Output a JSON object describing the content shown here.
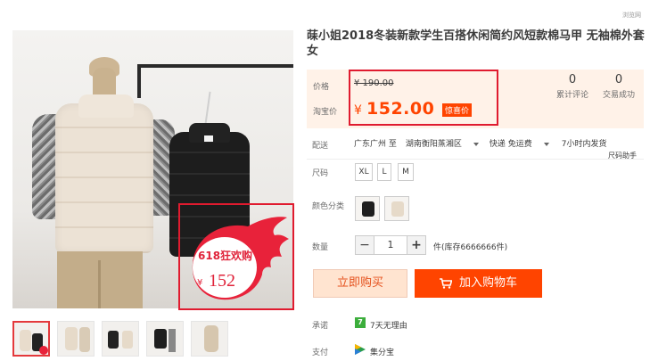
{
  "top_note": "浏览网",
  "promo": {
    "title": "618狂欢购",
    "currency": "¥",
    "price": "152"
  },
  "product": {
    "title": "菋小姐2018冬装新款学生百搭休闲简约风短款棉马甲 无袖棉外套女"
  },
  "price": {
    "label_price": "价格",
    "label_taobao": "淘宝价",
    "original": "¥ 190.00",
    "currency": "¥",
    "current": "152.00",
    "badge": "惊喜价"
  },
  "stats": [
    {
      "count": "0",
      "label": "累计评论"
    },
    {
      "count": "0",
      "label": "交易成功"
    }
  ],
  "shipping": {
    "label": "配送",
    "from": "广东广州 至",
    "to": "湖南衡阳蒸湘区",
    "method": "快递 免运费",
    "time": "7小时内发货"
  },
  "size": {
    "label": "尺码",
    "options": [
      "XL",
      "L",
      "M"
    ],
    "help": "尺码助手"
  },
  "color": {
    "label": "颜色分类"
  },
  "quantity": {
    "label": "数量",
    "minus": "−",
    "value": "1",
    "plus": "+",
    "stock": "件(库存6666666件)"
  },
  "actions": {
    "buy_now": "立即购买",
    "add_cart": "加入购物车"
  },
  "service": {
    "promise_label": "承诺",
    "promise_icon": "7",
    "promise_text": "7天无理由",
    "pay_label": "支付",
    "pay_text": "集分宝"
  },
  "colors": {
    "accent": "#ff4400",
    "highlight": "#e01b2f",
    "panel": "#fff2e8"
  }
}
